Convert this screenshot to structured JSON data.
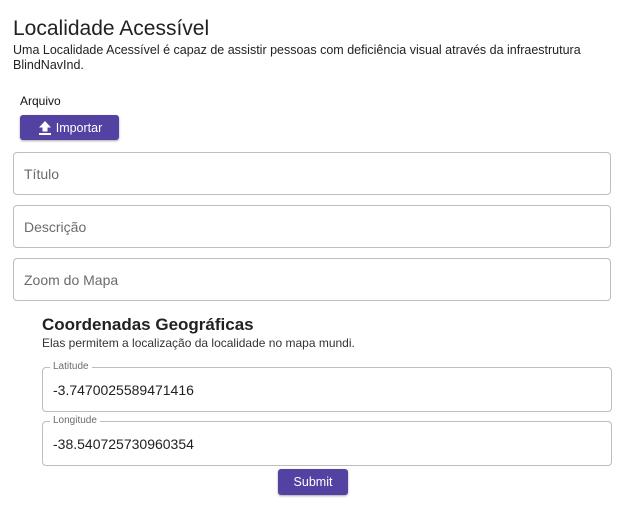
{
  "header": {
    "title": "Localidade Acessível",
    "subtitle": "Uma Localidade Acessível é capaz de assistir pessoas com deficiência visual através da infraestrutura BlindNavInd."
  },
  "file": {
    "label": "Arquivo",
    "import_label": "Importar",
    "import_icon": "upload-icon"
  },
  "form": {
    "title_placeholder": "Título",
    "description_placeholder": "Descrição",
    "zoom_placeholder": "Zoom do Mapa"
  },
  "coordinates": {
    "title": "Coordenadas Geográficas",
    "subtitle": "Elas permitem a localização da localidade no mapa mundi.",
    "latitude_label": "Latitude",
    "latitude_value": "-3.7470025589471416",
    "longitude_label": "Longitude",
    "longitude_value": "-38.540725730960354"
  },
  "actions": {
    "submit_label": "Submit"
  },
  "colors": {
    "accent": "#5442a3"
  }
}
